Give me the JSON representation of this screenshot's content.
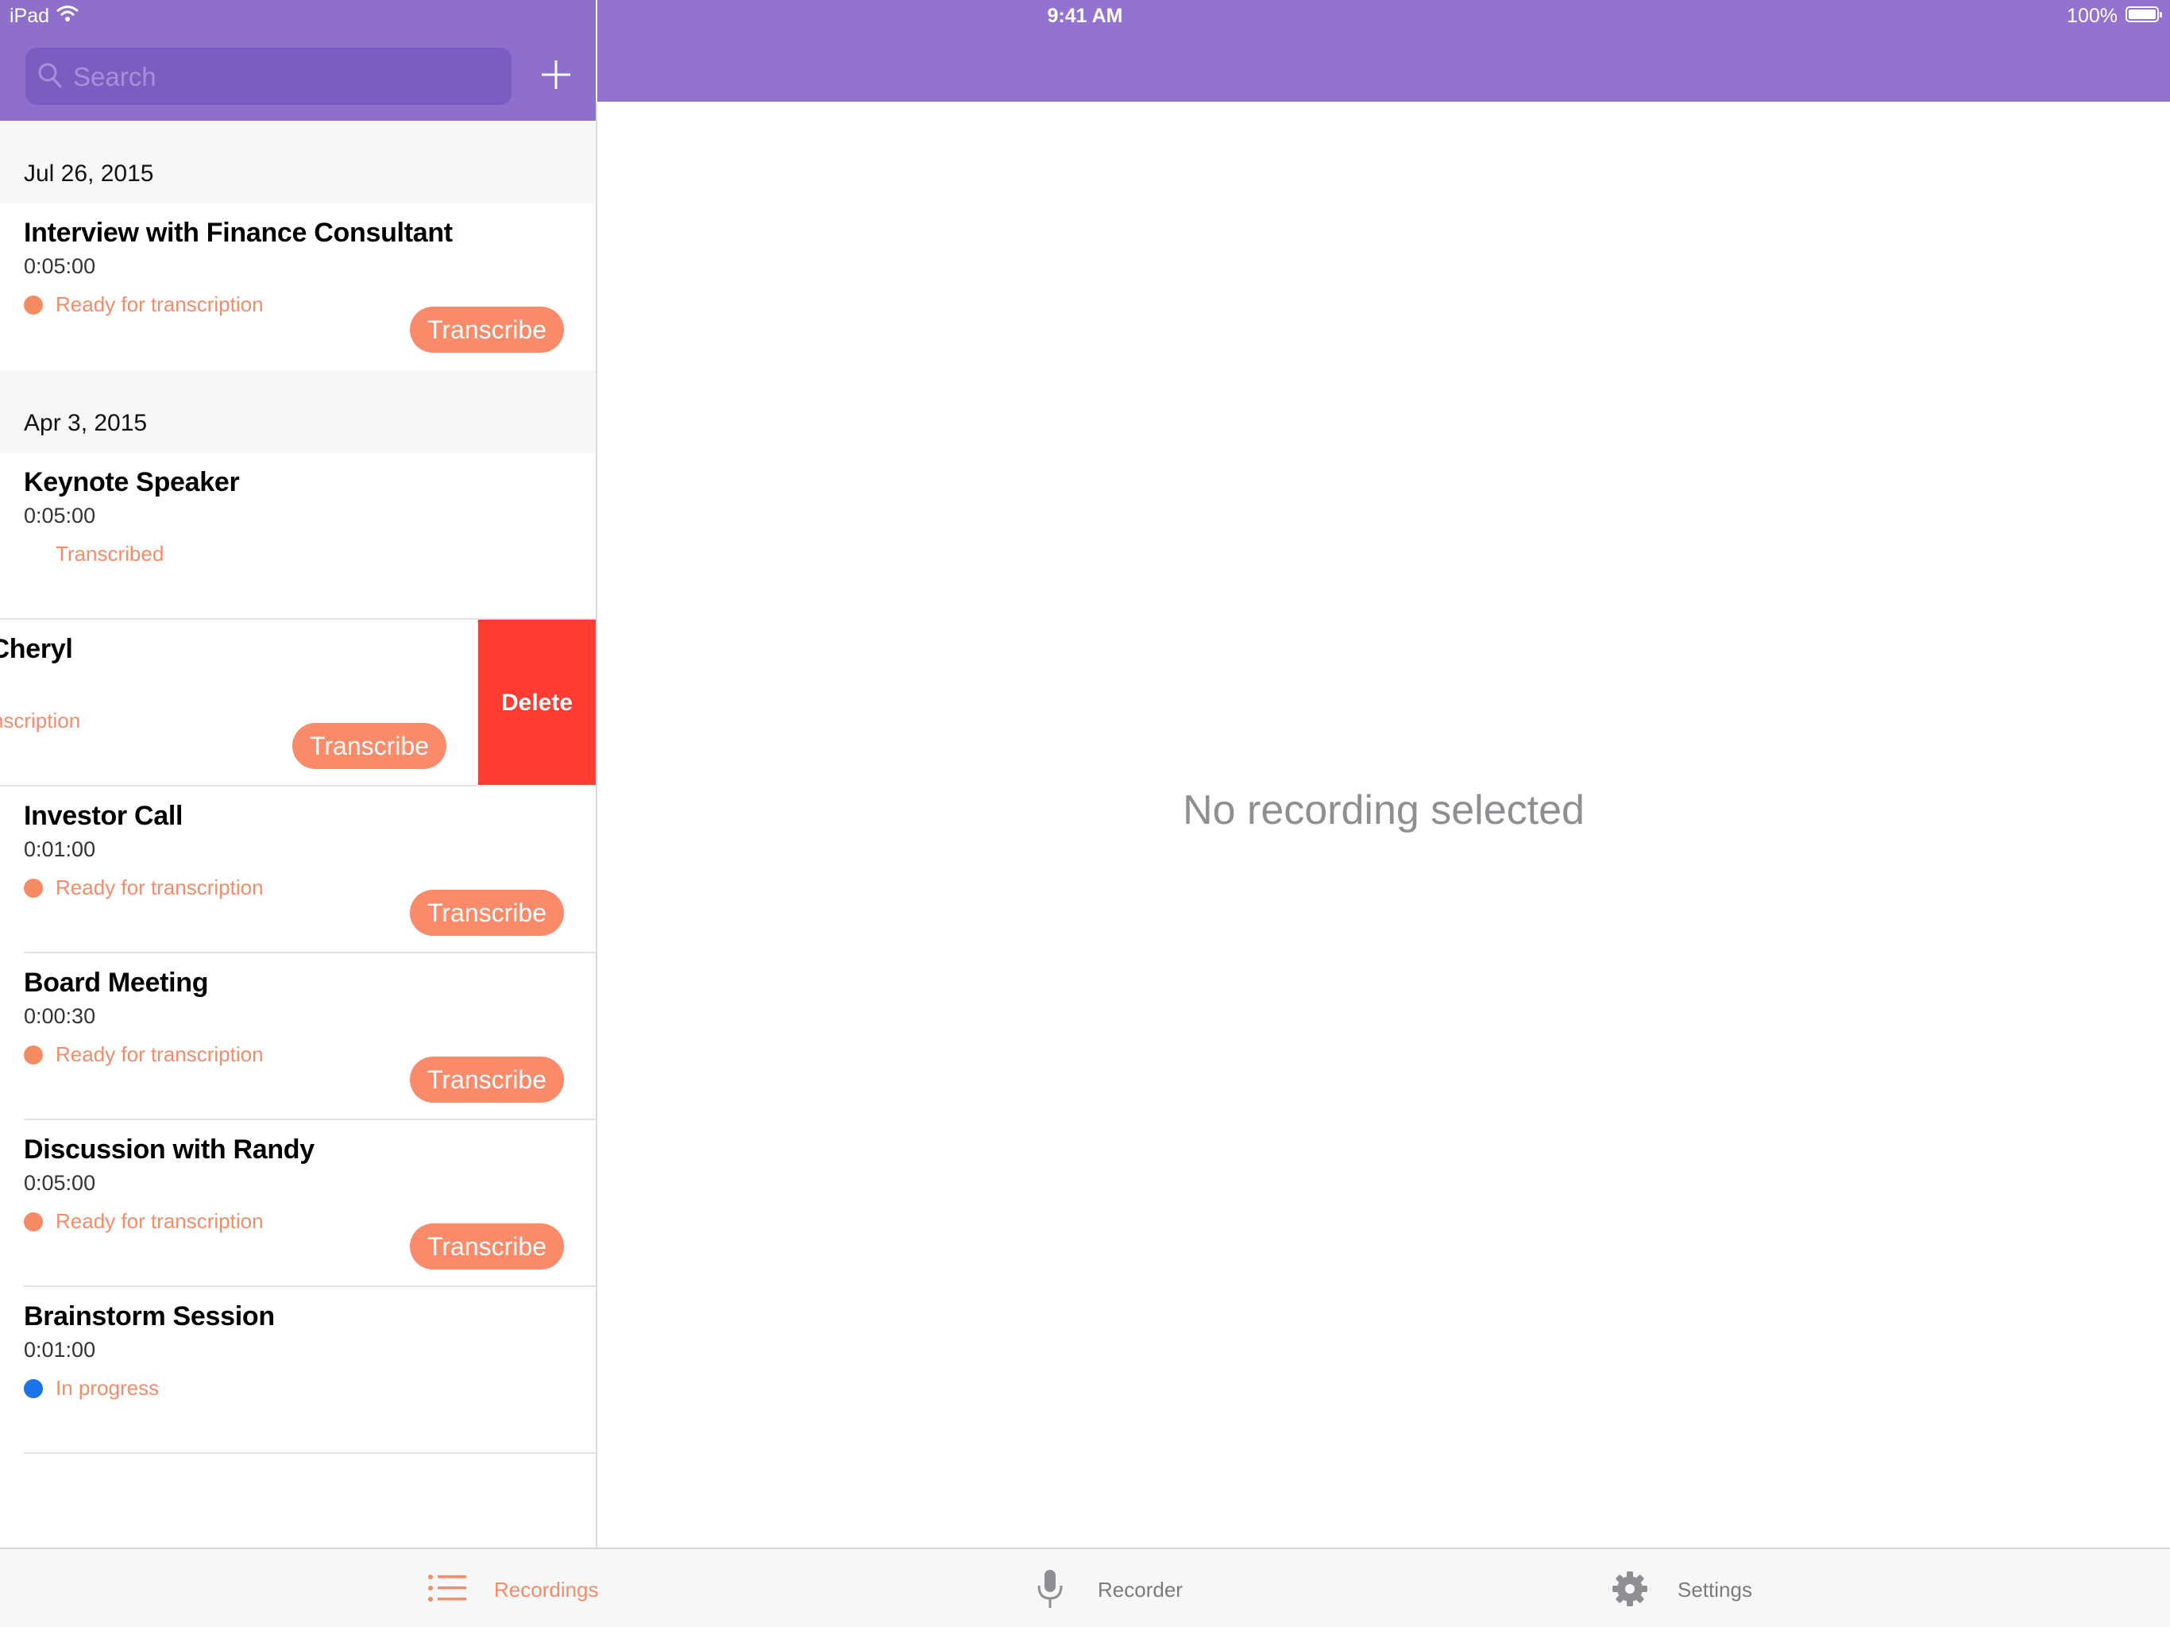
{
  "status_bar": {
    "device": "iPad",
    "time": "9:41 AM",
    "battery": "100%"
  },
  "search": {
    "placeholder": "Search",
    "value": ""
  },
  "sections": [
    {
      "date": "Jul 26, 2015",
      "items": [
        {
          "title": "Interview with Finance Consultant",
          "duration": "0:05:00",
          "status": "Ready for transcription",
          "action": "Transcribe"
        }
      ]
    },
    {
      "date": "Apr 3, 2015",
      "items": [
        {
          "title": "Keynote Speaker",
          "duration": "0:05:00",
          "status": "Transcribed"
        },
        {
          "title": "g with Cheryl",
          "status": "for transcription",
          "action": "Transcribe",
          "swipe_action": "Delete"
        },
        {
          "title": "Investor Call",
          "duration": "0:01:00",
          "status": "Ready for transcription",
          "action": "Transcribe"
        },
        {
          "title": "Board Meeting",
          "duration": "0:00:30",
          "status": "Ready for transcription",
          "action": "Transcribe"
        },
        {
          "title": "Discussion with Randy",
          "duration": "0:05:00",
          "status": "Ready for transcription",
          "action": "Transcribe"
        },
        {
          "title": "Brainstorm Session",
          "duration": "0:01:00",
          "status": "In progress"
        }
      ]
    }
  ],
  "detail": {
    "empty_message": "No recording selected"
  },
  "tabs": [
    {
      "label": "Recordings",
      "icon": "list-icon",
      "selected": true
    },
    {
      "label": "Recorder",
      "icon": "microphone-icon",
      "selected": false
    },
    {
      "label": "Settings",
      "icon": "gear-icon",
      "selected": false
    }
  ],
  "colors": {
    "nav": "#9372d0",
    "accent": "#f98b6a",
    "delete": "#fe3c31",
    "in_progress": "#1a73e8"
  }
}
